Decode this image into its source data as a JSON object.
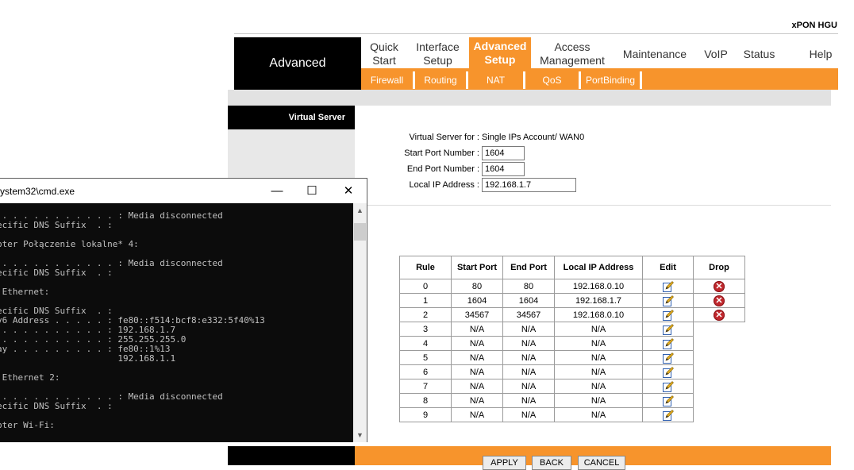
{
  "router": {
    "brand": "xPON HGU",
    "section_title": "Advanced",
    "menu": [
      {
        "label": "Quick\nStart",
        "active": false
      },
      {
        "label": "Interface\nSetup",
        "active": false
      },
      {
        "label": "Advanced\nSetup",
        "active": true
      },
      {
        "label": "Access\nManagement",
        "active": false
      },
      {
        "label": "Maintenance",
        "active": false
      },
      {
        "label": "VoIP",
        "active": false
      },
      {
        "label": "Status",
        "active": false
      },
      {
        "label": "Help",
        "active": false
      }
    ],
    "submenu": [
      "Firewall",
      "Routing",
      "NAT",
      "QoS",
      "PortBinding"
    ],
    "page_label": "Virtual Server",
    "form": {
      "vs_for_label": "Virtual Server for :",
      "vs_for_value": "Single IPs Account/ WAN0",
      "start_port_label": "Start Port Number :",
      "start_port_value": "1604",
      "end_port_label": "End Port Number :",
      "end_port_value": "1604",
      "local_ip_label": "Local IP Address :",
      "local_ip_value": "192.168.1.7"
    },
    "table": {
      "headers": [
        "Rule",
        "Start Port",
        "End Port",
        "Local IP Address",
        "Edit",
        "Drop"
      ],
      "rows": [
        {
          "rule": "0",
          "start": "80",
          "end": "80",
          "ip": "192.168.0.10",
          "drop": true
        },
        {
          "rule": "1",
          "start": "1604",
          "end": "1604",
          "ip": "192.168.1.7",
          "drop": true
        },
        {
          "rule": "2",
          "start": "34567",
          "end": "34567",
          "ip": "192.168.0.10",
          "drop": true
        },
        {
          "rule": "3",
          "start": "N/A",
          "end": "N/A",
          "ip": "N/A",
          "drop": false
        },
        {
          "rule": "4",
          "start": "N/A",
          "end": "N/A",
          "ip": "N/A",
          "drop": false
        },
        {
          "rule": "5",
          "start": "N/A",
          "end": "N/A",
          "ip": "N/A",
          "drop": false
        },
        {
          "rule": "6",
          "start": "N/A",
          "end": "N/A",
          "ip": "N/A",
          "drop": false
        },
        {
          "rule": "7",
          "start": "N/A",
          "end": "N/A",
          "ip": "N/A",
          "drop": false
        },
        {
          "rule": "8",
          "start": "N/A",
          "end": "N/A",
          "ip": "N/A",
          "drop": false
        },
        {
          "rule": "9",
          "start": "N/A",
          "end": "N/A",
          "ip": "N/A",
          "drop": false
        }
      ]
    },
    "buttons": {
      "apply": "APPLY",
      "back": "BACK",
      "cancel": "CANCEL"
    },
    "colors": {
      "accent": "#f7942c",
      "header": "#000000",
      "drop": "#c0282d"
    }
  },
  "cmd": {
    "title": "ystem32\\cmd.exe",
    "minimize": "—",
    "maximize": "☐",
    "close": "✕",
    "lines": [
      " . . . . . . . . . . . : Media disconnected",
      "ecific DNS Suffix  . :",
      "",
      "pter Połączenie lokalne* 4:",
      "",
      " . . . . . . . . . . . : Media disconnected",
      "ecific DNS Suffix  . :",
      "",
      " Ethernet:",
      "",
      "ecific DNS Suffix  . :",
      "v6 Address . . . . . : fe80::f514:bcf8:e332:5f40%13",
      " . . . . . . . . . . : 192.168.1.7",
      " . . . . . . . . . . : 255.255.255.0",
      "ay . . . . . . . . . : fe80::1%13",
      "                       192.168.1.1",
      "",
      " Ethernet 2:",
      "",
      " . . . . . . . . . . . : Media disconnected",
      "ecific DNS Suffix  . :",
      "",
      "pter Wi-Fi:"
    ]
  }
}
